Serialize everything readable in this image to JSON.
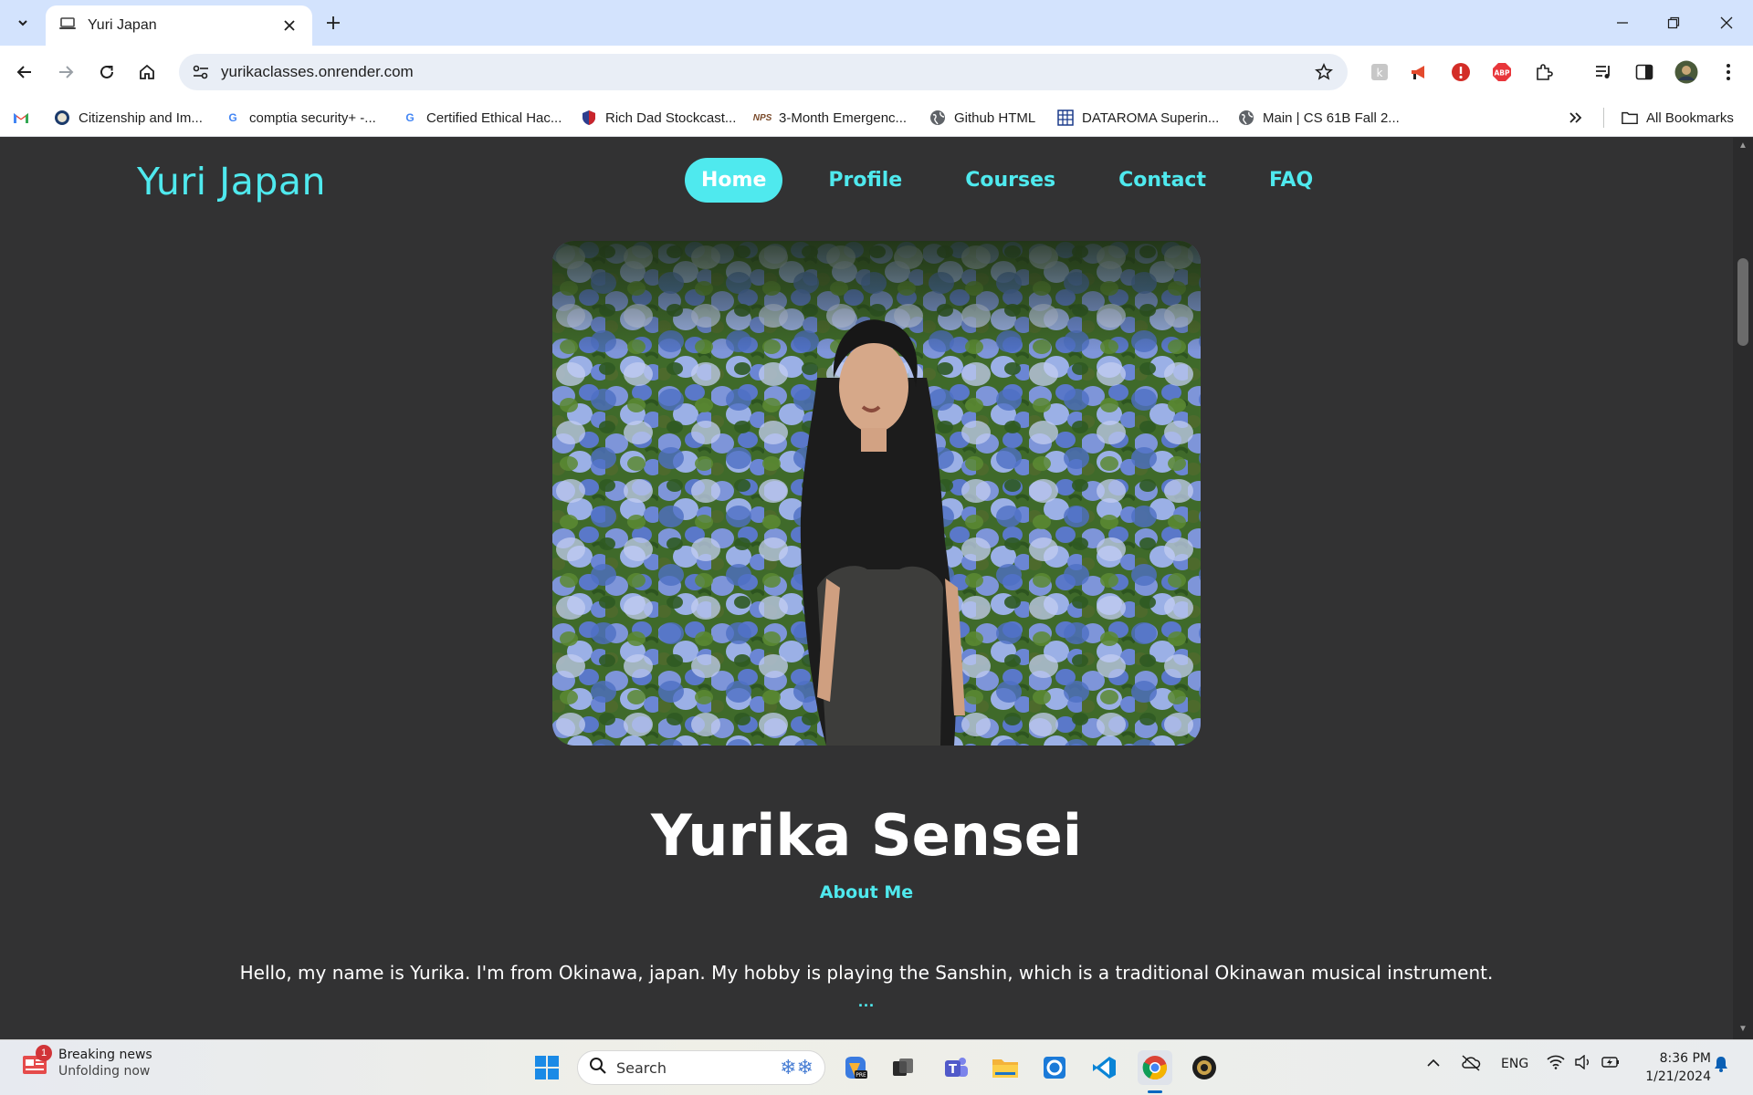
{
  "browser": {
    "tab_title": "Yuri Japan",
    "url": "yurikaclasses.onrender.com",
    "bookmarks": [
      {
        "label": "",
        "icon": "gmail-icon"
      },
      {
        "label": "Citizenship and Im...",
        "icon": "uscis-seal-icon"
      },
      {
        "label": "comptia security+ -...",
        "icon": "google-icon"
      },
      {
        "label": "Certified Ethical Hac...",
        "icon": "google-icon"
      },
      {
        "label": "Rich Dad Stockcast...",
        "icon": "shield-icon"
      },
      {
        "label": "3-Month Emergenc...",
        "icon": "nps-icon"
      },
      {
        "label": "Github HTML",
        "icon": "globe-icon"
      },
      {
        "label": "DATAROMA Superin...",
        "icon": "grid-icon"
      },
      {
        "label": "Main | CS 61B Fall 2...",
        "icon": "globe-icon"
      }
    ],
    "all_bookmarks_label": "All Bookmarks"
  },
  "site": {
    "logo": "Yuri Japan",
    "nav": [
      {
        "label": "Home",
        "active": true
      },
      {
        "label": "Profile",
        "active": false
      },
      {
        "label": "Courses",
        "active": false
      },
      {
        "label": "Contact",
        "active": false
      },
      {
        "label": "FAQ",
        "active": false
      }
    ],
    "hero_name": "Yurika Sensei",
    "about_label": "About Me",
    "bio": "Hello, my name is Yurika. I'm from Okinawa, japan. My hobby is playing the Sanshin, which is a traditional Okinawan musical instrument.",
    "more": "...",
    "accent": "#4fe9ee",
    "background": "#323233"
  },
  "taskbar": {
    "news_title": "Breaking news",
    "news_sub": "Unfolding now",
    "news_badge": "1",
    "search_placeholder": "Search",
    "language": "ENG",
    "time": "8:36 PM",
    "date": "1/21/2024"
  }
}
